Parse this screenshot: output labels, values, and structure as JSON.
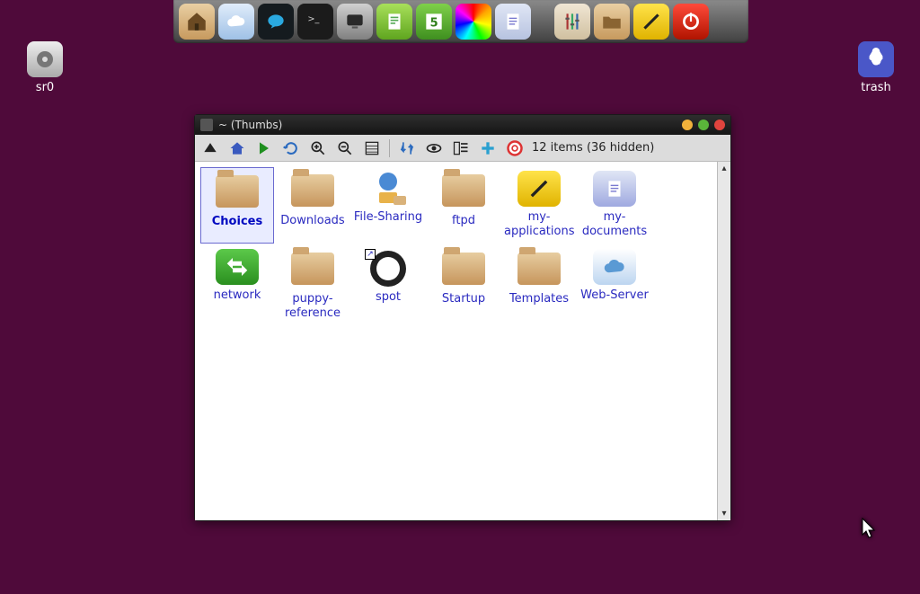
{
  "desktop": {
    "icons": [
      {
        "name": "sr0",
        "kind": "disc-icon"
      },
      {
        "name": "trash",
        "kind": "trash-icon"
      }
    ]
  },
  "dock": {
    "items": [
      {
        "name": "files-icon"
      },
      {
        "name": "cloud-icon"
      },
      {
        "name": "chat-icon"
      },
      {
        "name": "terminal-icon"
      },
      {
        "name": "monitor-icon"
      },
      {
        "name": "text-editor-icon"
      },
      {
        "name": "spreadsheet-icon"
      },
      {
        "name": "color-settings-icon"
      },
      {
        "name": "document-icon"
      },
      {
        "gap": true
      },
      {
        "name": "mixer-icon"
      },
      {
        "name": "folder-icon"
      },
      {
        "name": "ruler-icon"
      },
      {
        "name": "power-icon"
      }
    ]
  },
  "window": {
    "title": "~ (Thumbs)",
    "status": "12 items (36 hidden)",
    "items": [
      {
        "label": "Choices",
        "icon": "folder",
        "selected": true
      },
      {
        "label": "Downloads",
        "icon": "folder"
      },
      {
        "label": "File-Sharing",
        "icon": "share"
      },
      {
        "label": "ftpd",
        "icon": "folder"
      },
      {
        "label": "my-applications",
        "icon": "app-yellow"
      },
      {
        "label": "my-documents",
        "icon": "app-doc"
      },
      {
        "label": "network",
        "icon": "app-green"
      },
      {
        "label": "puppy-reference",
        "icon": "folder"
      },
      {
        "label": "spot",
        "icon": "spot",
        "symlink": true
      },
      {
        "label": "Startup",
        "icon": "folder"
      },
      {
        "label": "Templates",
        "icon": "folder"
      },
      {
        "label": "Web-Server",
        "icon": "app-cloud"
      }
    ]
  }
}
